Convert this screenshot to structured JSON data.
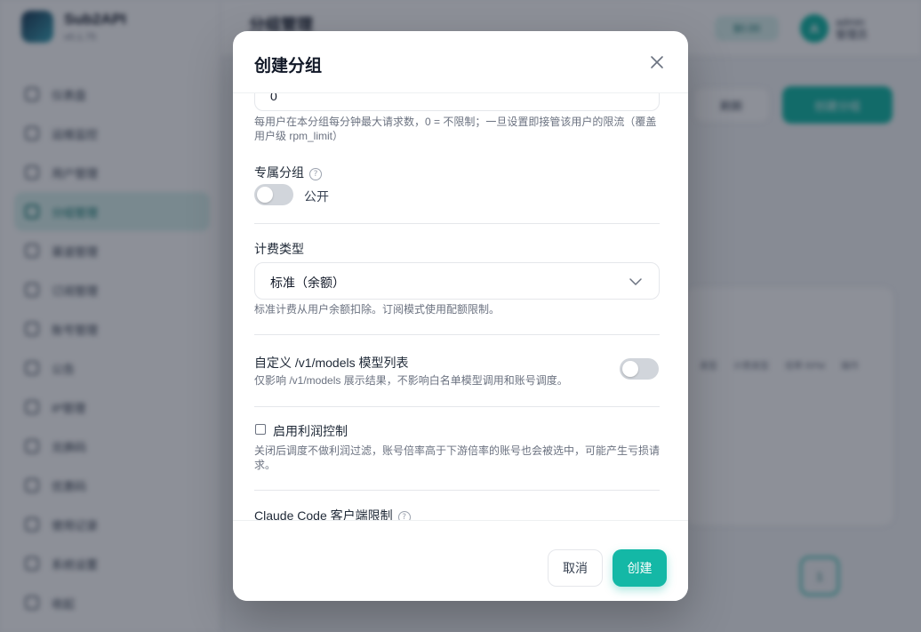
{
  "app": {
    "brand_name": "Sub2API",
    "brand_sub": "v0.1.75",
    "nav": [
      {
        "label": "仪表盘",
        "active": false
      },
      {
        "label": "运维监控",
        "active": false
      },
      {
        "label": "用户管理",
        "active": false
      },
      {
        "label": "分组管理",
        "active": true
      },
      {
        "label": "渠道管理",
        "active": false
      },
      {
        "label": "订阅管理",
        "active": false
      },
      {
        "label": "账号管理",
        "active": false
      },
      {
        "label": "公告",
        "active": false
      },
      {
        "label": "IP管理",
        "active": false
      },
      {
        "label": "兑换码",
        "active": false
      },
      {
        "label": "优惠码",
        "active": false
      },
      {
        "label": "使用记录",
        "active": false
      },
      {
        "label": "系统设置",
        "active": false
      },
      {
        "label": "收起",
        "active": false
      }
    ],
    "top_title": "分组管理",
    "balance": "$0.00",
    "avatar_letter": "A",
    "user_name": "admin",
    "user_role": "管理员",
    "refresh_label": "刷新",
    "create_group_label": "创建分组",
    "table_columns": [
      "类型",
      "计费类型",
      "倍率 RPM",
      "操作"
    ],
    "page_number": "1"
  },
  "modal": {
    "title": "创建分组",
    "rpm_value": "0",
    "rpm_help": "每用户在本分组每分钟最大请求数，0 = 不限制；一旦设置即接管该用户的限流（覆盖用户级 rpm_limit）",
    "exclusive_label": "专属分组",
    "exclusive_state_text": "公开",
    "exclusive_on": false,
    "billing_label": "计费类型",
    "billing_value": "标准（余额）",
    "billing_help": "标准计费从用户余额扣除。订阅模式使用配额限制。",
    "models_label": "自定义 /v1/models 模型列表",
    "models_help": "仅影响 /v1/models 展示结果，不影响白名单模型调用和账号调度。",
    "models_on": false,
    "profit_label": "启用利润控制",
    "profit_checked": false,
    "profit_help": "关闭后调度不做利润过滤，账号倍率高于下游倍率的账号也会被选中，可能产生亏损请求。",
    "claude_label": "Claude Code 客户端限制",
    "cancel_label": "取消",
    "create_label": "创建"
  }
}
